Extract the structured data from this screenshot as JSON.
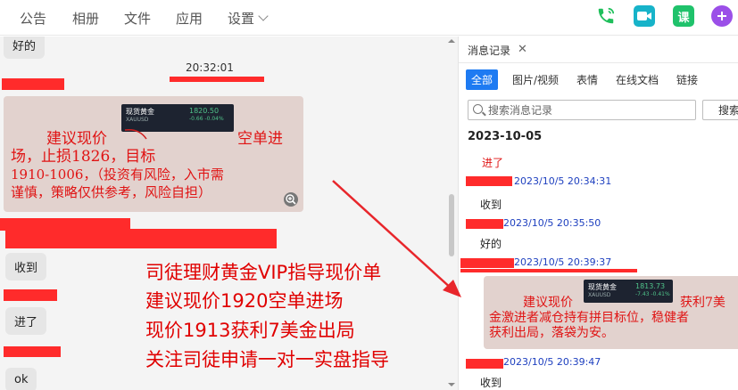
{
  "nav": {
    "items": [
      "公告",
      "相册",
      "文件",
      "应用",
      "设置"
    ]
  },
  "icons": {
    "phone": "phone-icon",
    "video": "video-icon",
    "course_label": "课",
    "plus": "plus-icon"
  },
  "colors": {
    "phone_green": "#1fbf5b",
    "video_teal": "#17b3c9",
    "course_green": "#1fc26b",
    "plus_purple": "#9b4fe8",
    "active_tab": "#1e7bf2",
    "alert_red": "#ff2b2b"
  },
  "chat": {
    "top_partial": "好的",
    "time": "20:32:01",
    "msg_received": "收到",
    "msg_entered": "进了",
    "msg_ok": "ok",
    "image1": {
      "line1_a": "建议现价",
      "line1_b": "空单进",
      "line2": "场，止损1826，目标",
      "line3": "1910-1006，（投资有风险，入市需",
      "line4": "谨慎，策略仅供参考，风险自担）",
      "card_title": "现货黄金",
      "card_sub": "XAUUSD",
      "card_price": "1820.50",
      "card_change": "-0.66  -0.04%"
    },
    "promo": [
      "司徒理财黄金VIP指导现价单",
      "建议现价1920空单进场",
      "现价1913获利7美金出局",
      "关注司徒申请一对一实盘指导"
    ]
  },
  "panel": {
    "tab_title": "消息记录",
    "filters": [
      "全部",
      "图片/视频",
      "表情",
      "在线文档",
      "链接"
    ],
    "search_placeholder": "搜索消息记录",
    "search_button": "搜索",
    "date": "2023-10-05",
    "messages": [
      {
        "text": "进了"
      },
      {
        "time": "2023/10/5 20:34:31",
        "text": "收到"
      },
      {
        "time": "2023/10/5 20:35:50",
        "text": "好的"
      },
      {
        "time": "2023/10/5 20:39:37"
      },
      {
        "time": "2023/10/5 20:39:47",
        "text": "收到"
      }
    ],
    "image2": {
      "line1_a": "建议现价",
      "line1_b": "获利7美",
      "line2": "金激进者减仓持有拼目标位，稳健者",
      "line3": "获利出局，落袋为安。",
      "card_title": "现货黄金",
      "card_sub": "XAUUSD",
      "card_price": "1813.73",
      "card_change": "-7.43  -0.41%"
    }
  }
}
